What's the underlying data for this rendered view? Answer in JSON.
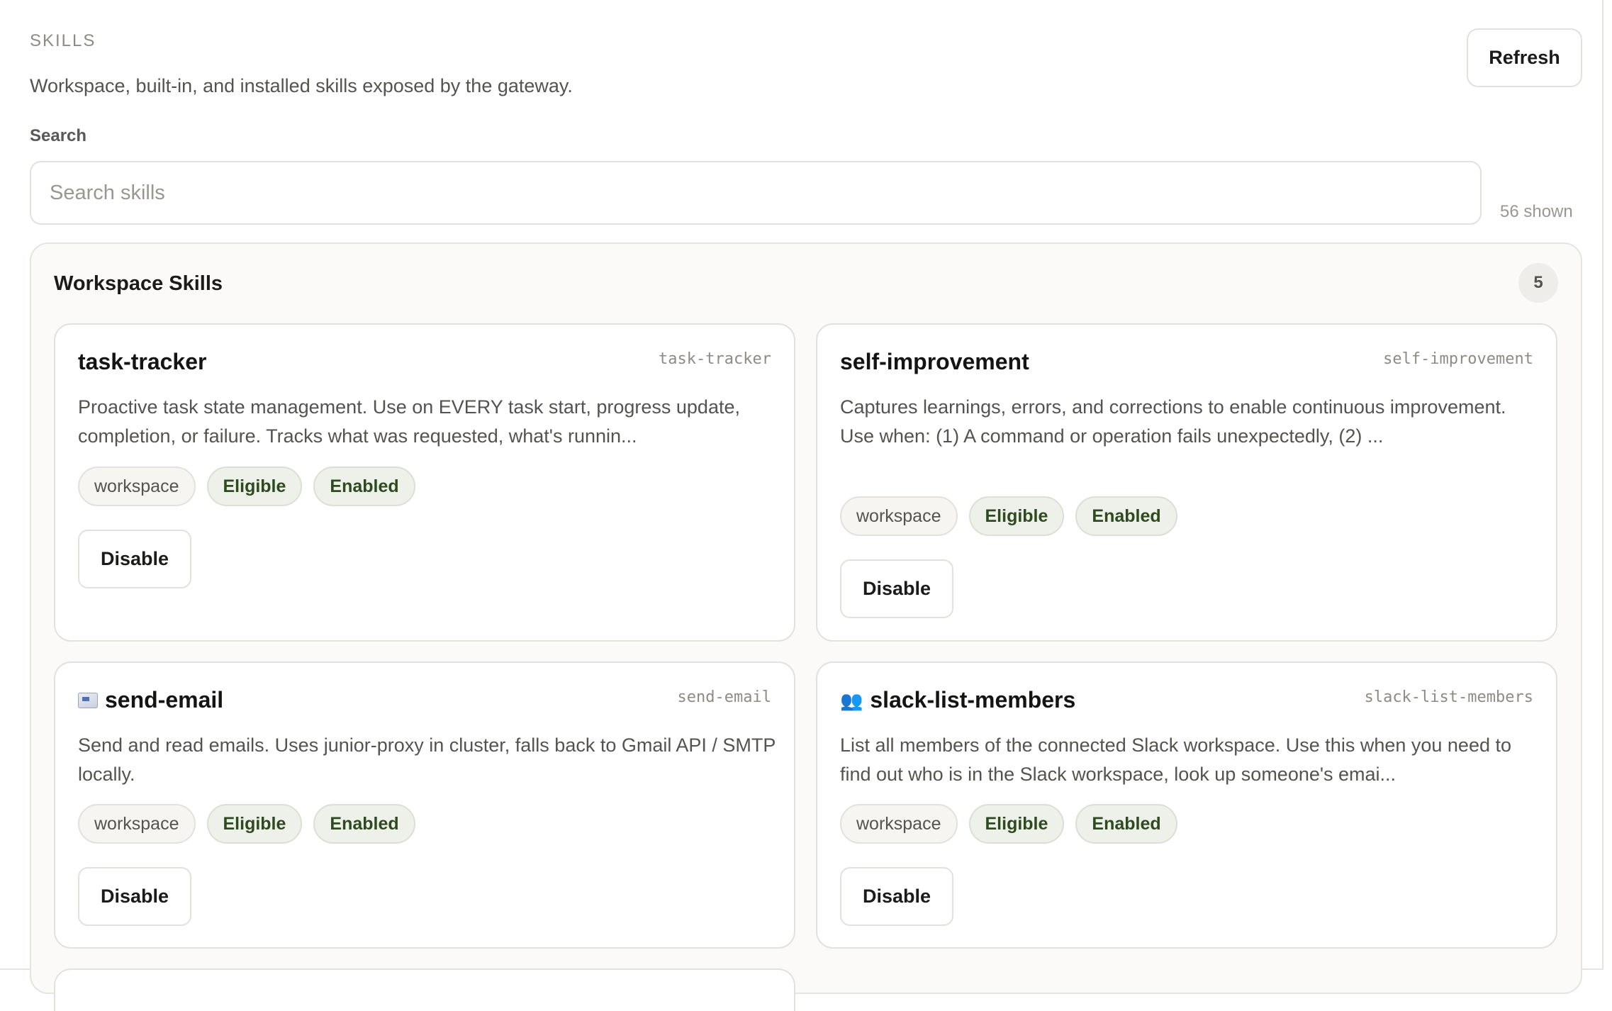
{
  "header": {
    "section_label": "SKILLS",
    "subtitle": "Workspace, built-in, and installed skills exposed by the gateway.",
    "refresh_label": "Refresh"
  },
  "search": {
    "label": "Search",
    "placeholder": "Search skills",
    "value": "",
    "shown": "56 shown"
  },
  "group": {
    "title": "Workspace Skills",
    "count": "5",
    "cards": [
      {
        "title": "task-tracker",
        "id": "task-tracker",
        "icon": "",
        "description": "Proactive task state management. Use on EVERY task start, progress update, completion, or failure. Tracks what was requested, what's runnin...",
        "badges": [
          "workspace",
          "Eligible",
          "Enabled"
        ],
        "button": "Disable"
      },
      {
        "title": "self-improvement",
        "id": "self-improvement",
        "icon": "",
        "description": "Captures learnings, errors, and corrections to enable continuous improvement. Use when: (1) A command or operation fails unexpectedly, (2) ...",
        "badges": [
          "workspace",
          "Eligible",
          "Enabled"
        ],
        "button": "Disable"
      },
      {
        "title": "send-email",
        "id": "send-email",
        "icon": "mail-icon",
        "description": "Send and read emails. Uses junior-proxy in cluster, falls back to Gmail API / SMTP locally.",
        "badges": [
          "workspace",
          "Eligible",
          "Enabled"
        ],
        "button": "Disable"
      },
      {
        "title": "slack-list-members",
        "id": "slack-list-members",
        "icon": "people-icon",
        "description": "List all members of the connected Slack workspace. Use this when you need to find out who is in the Slack workspace, look up someone's emai...",
        "badges": [
          "workspace",
          "Eligible",
          "Enabled"
        ],
        "button": "Disable"
      }
    ]
  },
  "colors": {
    "accent_badge_text": "#2e4a1f",
    "muted_text": "#8e8b84",
    "border": "#e3e1dc"
  }
}
